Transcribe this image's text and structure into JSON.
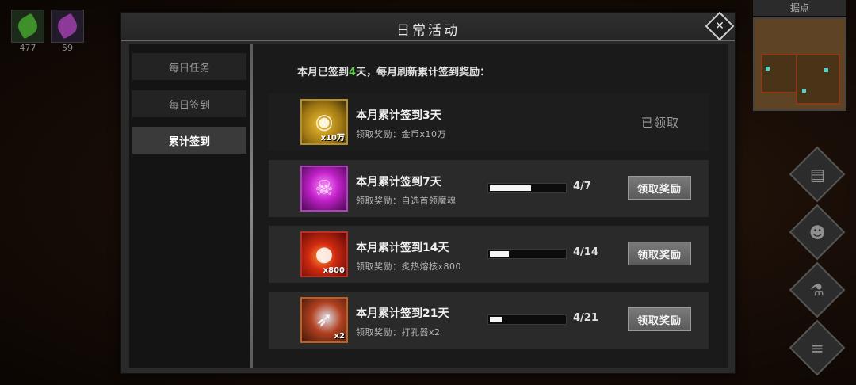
{
  "hud": {
    "slots": [
      {
        "icon": "green-gem-icon",
        "count": "477"
      },
      {
        "icon": "purple-feather-icon",
        "count": "59"
      }
    ],
    "minimap_label": "据点"
  },
  "dialog": {
    "title": "日常活动",
    "close_icon": "close-icon"
  },
  "tabs": [
    {
      "label": "每日任务",
      "active": false
    },
    {
      "label": "每日签到",
      "active": false
    },
    {
      "label": "累计签到",
      "active": true
    }
  ],
  "summary": {
    "prefix": "本月已签到",
    "days": "4",
    "suffix": "天，每月刷新累计签到奖励："
  },
  "rewards": [
    {
      "title": "本月累计签到3天",
      "subtitle": "领取奖励：金币x10万",
      "icon": "gold-coins-icon",
      "qty": "x10万",
      "status": "已领取",
      "progress": null
    },
    {
      "title": "本月累计签到7天",
      "subtitle": "领取奖励：自选首领魔魂",
      "icon": "boss-soul-icon",
      "qty": "",
      "progress_text": "4/7",
      "progress": 0.571,
      "button": "领取奖励"
    },
    {
      "title": "本月累计签到14天",
      "subtitle": "领取奖励：炙热熔核x800",
      "icon": "molten-core-icon",
      "qty": "x800",
      "progress_text": "4/14",
      "progress": 0.286,
      "button": "领取奖励"
    },
    {
      "title": "本月累计签到21天",
      "subtitle": "领取奖励：打孔器x2",
      "icon": "drill-icon",
      "qty": "x2",
      "progress_text": "4/21",
      "progress": 0.19,
      "button": "领取奖励"
    }
  ],
  "side_buttons": [
    "quest-scroll-icon",
    "friends-icon",
    "potion-icon",
    "menu-list-icon"
  ]
}
